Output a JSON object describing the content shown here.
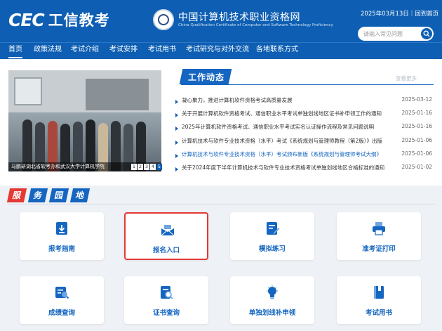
{
  "header": {
    "logo_mark": "CEC",
    "logo_text": "工信教考",
    "org_cn": "中国计算机技术职业资格网",
    "org_en": "China Qualification Certificate of Computer and Software Technology Proficiency",
    "date_text": "2025年03月13日｜回到首页",
    "search_placeholder": "请输入常见问题"
  },
  "nav": {
    "items": [
      "首页",
      "政策法规",
      "考试介绍",
      "考试安排",
      "考试用书",
      "考试研究与对外交流",
      "各地联系方式"
    ],
    "active_index": 0
  },
  "carousel": {
    "caption": "马鹏研湖北省软考办和武汉大学计算机学院",
    "pages": [
      "1",
      "2",
      "3",
      "4",
      "5"
    ],
    "active_page": 5
  },
  "news": {
    "title": "工作动态",
    "more": "查看更多",
    "items": [
      {
        "text": "凝心聚力，推进计算机软件资格考试高质量发展",
        "date": "2025-03-12",
        "highlight": false
      },
      {
        "text": "关于开展计算机软件资格考试、通信职业水平考试单独划线地区证书补申领工作的通知",
        "date": "2025-01-16",
        "highlight": false
      },
      {
        "text": "2025年计算机软件资格考试、通信职业水平考试实名认证操作流程及常见问题说明",
        "date": "2025-01-16",
        "highlight": false
      },
      {
        "text": "计算机技术与软件专业技术资格（水平）考试《系统规划与管理师教程（第2版）》出版",
        "date": "2025-01-06",
        "highlight": false
      },
      {
        "text": "计算机技术与软件专业技术资格（水平）考试颁布新版《系统规划与管理师考试大纲》",
        "date": "2025-01-06",
        "highlight": true
      },
      {
        "text": "关于2024年度下半年计算机技术与软件专业技术资格考试单独划线地区合格标准的通知",
        "date": "2025-01-02",
        "highlight": false
      }
    ]
  },
  "services": {
    "heading_chars": [
      "服",
      "务",
      "园",
      "地"
    ],
    "cards": [
      {
        "label": "报考指南",
        "icon": "guide-icon"
      },
      {
        "label": "报名入口",
        "icon": "registration-icon"
      },
      {
        "label": "模拟练习",
        "icon": "practice-icon"
      },
      {
        "label": "准考证打印",
        "icon": "printer-icon"
      },
      {
        "label": "成绩查询",
        "icon": "score-query-icon"
      },
      {
        "label": "证书查询",
        "icon": "certificate-query-icon"
      },
      {
        "label": "单独划线补申领",
        "icon": "lightbulb-icon"
      },
      {
        "label": "考试用书",
        "icon": "book-icon"
      }
    ],
    "selected_index": 1
  },
  "colors": {
    "brand_blue": "#0e5fb3",
    "link_blue": "#1566c0",
    "accent_red": "#e53935"
  }
}
